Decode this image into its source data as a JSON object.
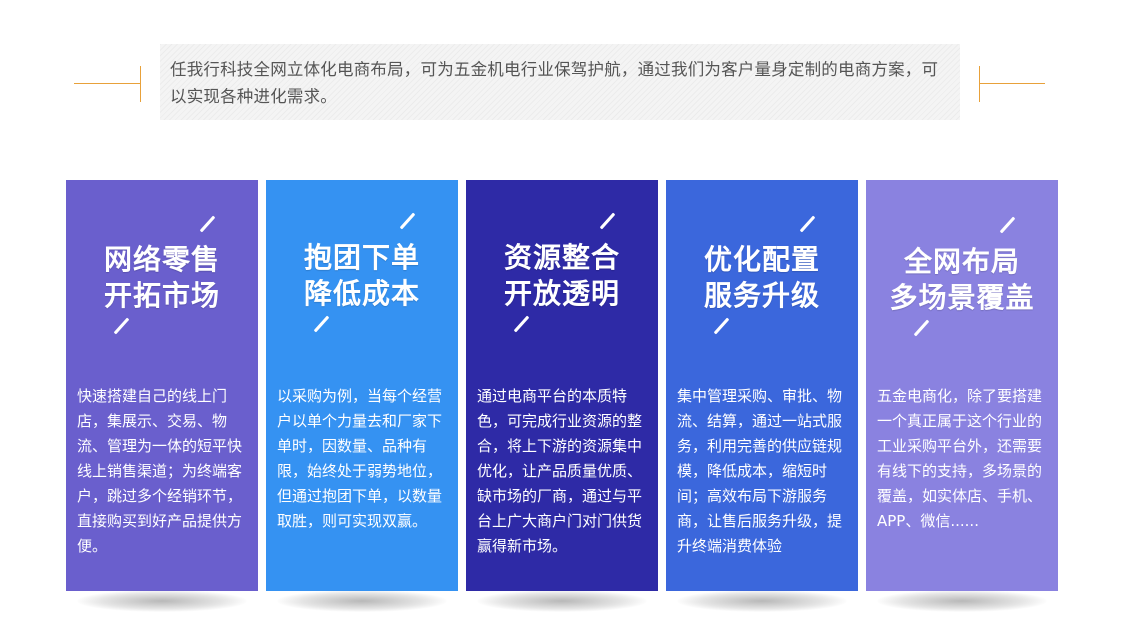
{
  "intro": {
    "text": "任我行科技全网立体化电商布局，可为五金机电行业保驾护航，通过我们为客户量身定制的电商方案，可以实现各种进化需求。",
    "line_color": "#e8a13a"
  },
  "cards": [
    {
      "title_line1": "网络零售",
      "title_line2": "开拓市场",
      "description": "快速搭建自己的线上门店，集展示、交易、物流、管理为一体的短平快线上销售渠道；为终端客户，跳过多个经销环节，直接购买到好产品提供方便。",
      "color": "#6a5fcd"
    },
    {
      "title_line1": "抱团下单",
      "title_line2": "降低成本",
      "description": "以采购为例，当每个经营户以单个力量去和厂家下单时，因数量、品种有限，始终处于弱势地位，但通过抱团下单，以数量取胜，则可实现双赢。",
      "color": "#3592f2"
    },
    {
      "title_line1": "资源整合",
      "title_line2": "开放透明",
      "description": "通过电商平台的本质特色，可完成行业资源的整合，将上下游的资源集中优化，让产品质量优质、缺市场的厂商，通过与平台上广大商户门对门供货赢得新市场。",
      "color": "#2e2aa6"
    },
    {
      "title_line1": "优化配置",
      "title_line2": "服务升级",
      "description": "集中管理采购、审批、物流、结算，通过一站式服务，利用完善的供应链规模，降低成本，缩短时间；高效布局下游服务商，让售后服务升级，提升终端消费体验",
      "color": "#3b67dc"
    },
    {
      "title_line1": "全网布局",
      "title_line2": "多场景覆盖",
      "description": "五金电商化，除了要搭建一个真正属于这个行业的工业采购平台外，还需要有线下的支持，多场景的覆盖，如实体店、手机、APP、微信......",
      "color": "#8a82e0"
    }
  ]
}
